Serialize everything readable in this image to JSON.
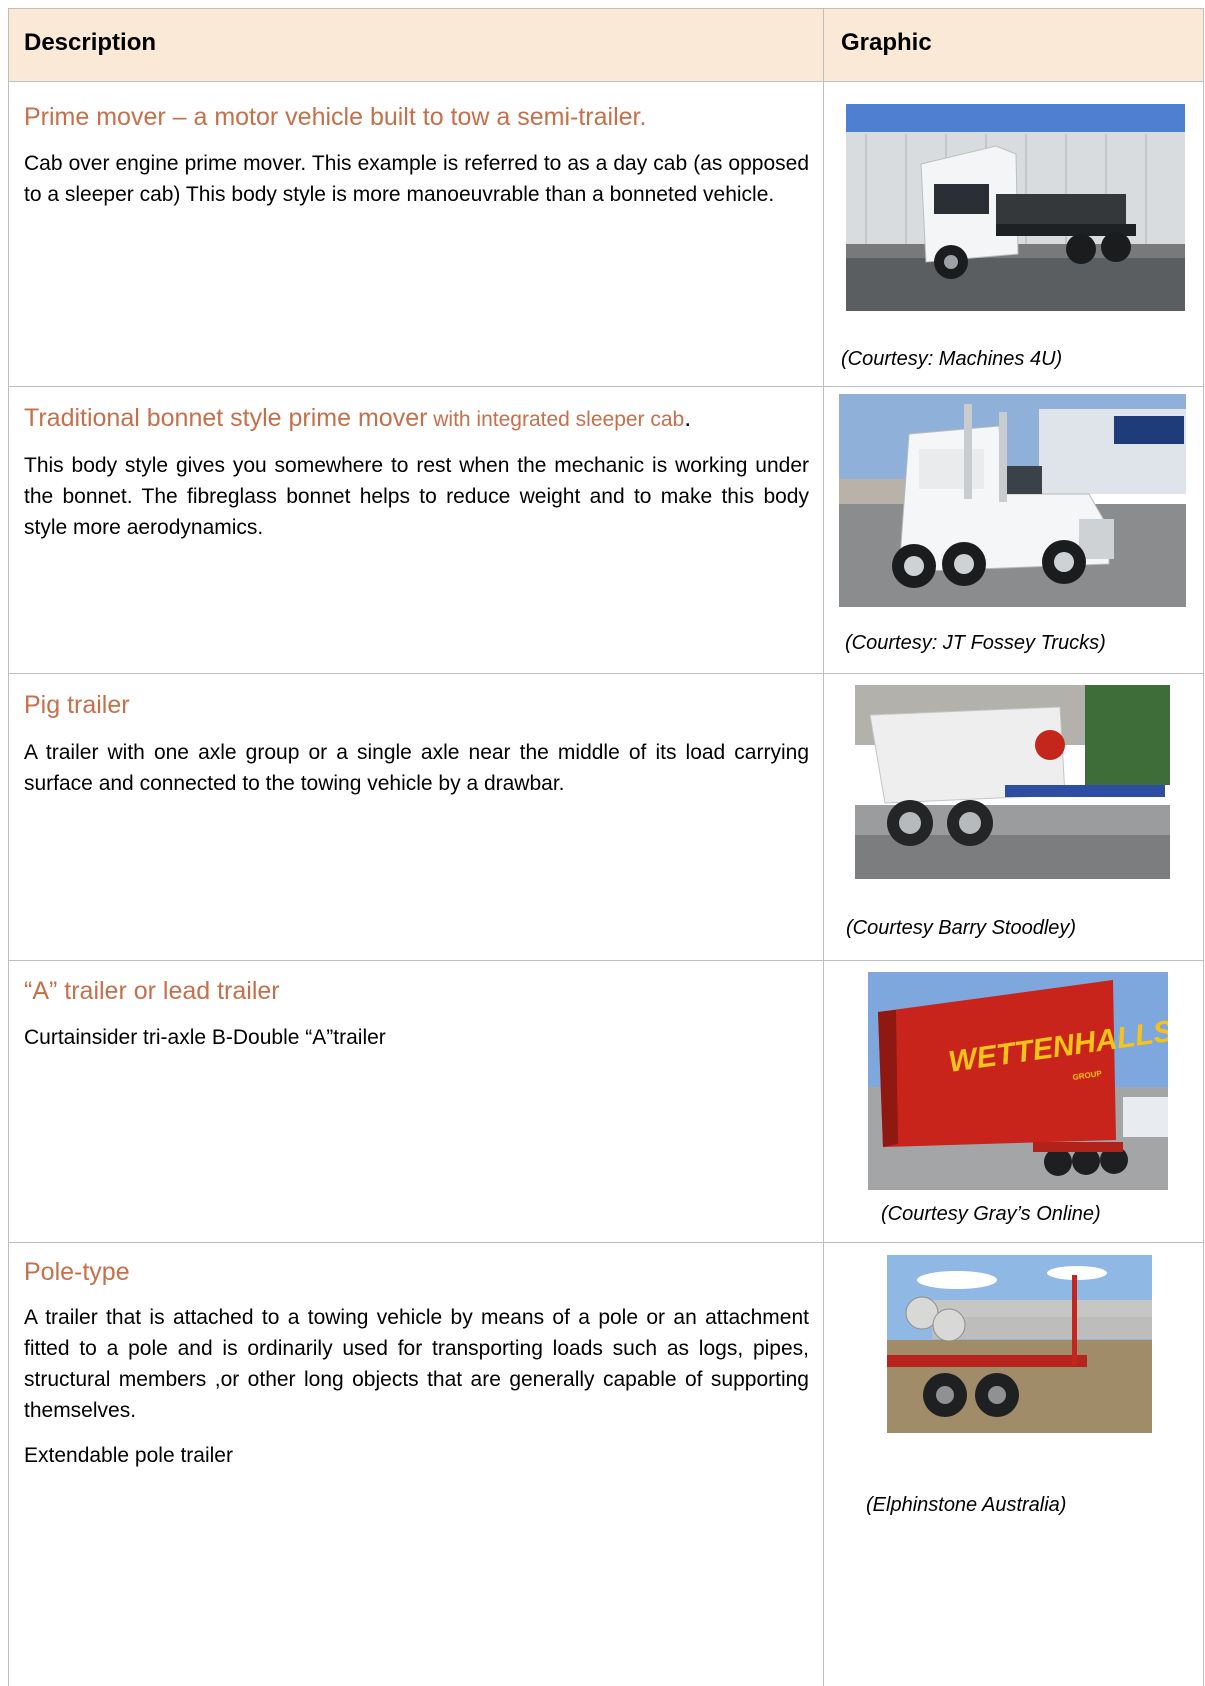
{
  "header": {
    "description": "Description",
    "graphic": "Graphic"
  },
  "rows": [
    {
      "title": "Prime mover – a motor vehicle built to tow a semi-trailer.",
      "body": "Cab over engine prime mover. This example is referred to as a day cab (as opposed to a sleeper cab) This body style is more manoeuvrable than a bonneted vehicle.",
      "caption": "(Courtesy: Machines 4U)"
    },
    {
      "title_main": "Traditional bonnet style prime mover",
      "title_small": " with integrated sleeper cab",
      "title_end": ".",
      "body": "This body style gives you somewhere to rest when the mechanic is working under the bonnet. The fibreglass bonnet helps to reduce weight and to make this body style more aerodynamics.",
      "caption": "(Courtesy: JT Fossey Trucks)"
    },
    {
      "title": "Pig trailer",
      "body": "A trailer with one axle group or a single axle near the middle of its load carrying surface and connected to the towing vehicle by a drawbar.",
      "caption": "(Courtesy Barry Stoodley)"
    },
    {
      "title": "“A” trailer or lead trailer",
      "body": "Curtainsider tri-axle B-Double “A”trailer",
      "caption": "(Courtesy Gray’s Online)",
      "sign_text": "WETTENHALLS",
      "sign_sub": "GROUP"
    },
    {
      "title": "Pole-type",
      "body": "A trailer that is attached to a towing vehicle by means of a pole or an attachment fitted to a pole and is ordinarily used for transporting loads such as logs, pipes, structural members ,or other long objects that are generally capable of supporting themselves.",
      "body2": "Extendable pole trailer",
      "caption": "(Elphinstone Australia)"
    }
  ]
}
